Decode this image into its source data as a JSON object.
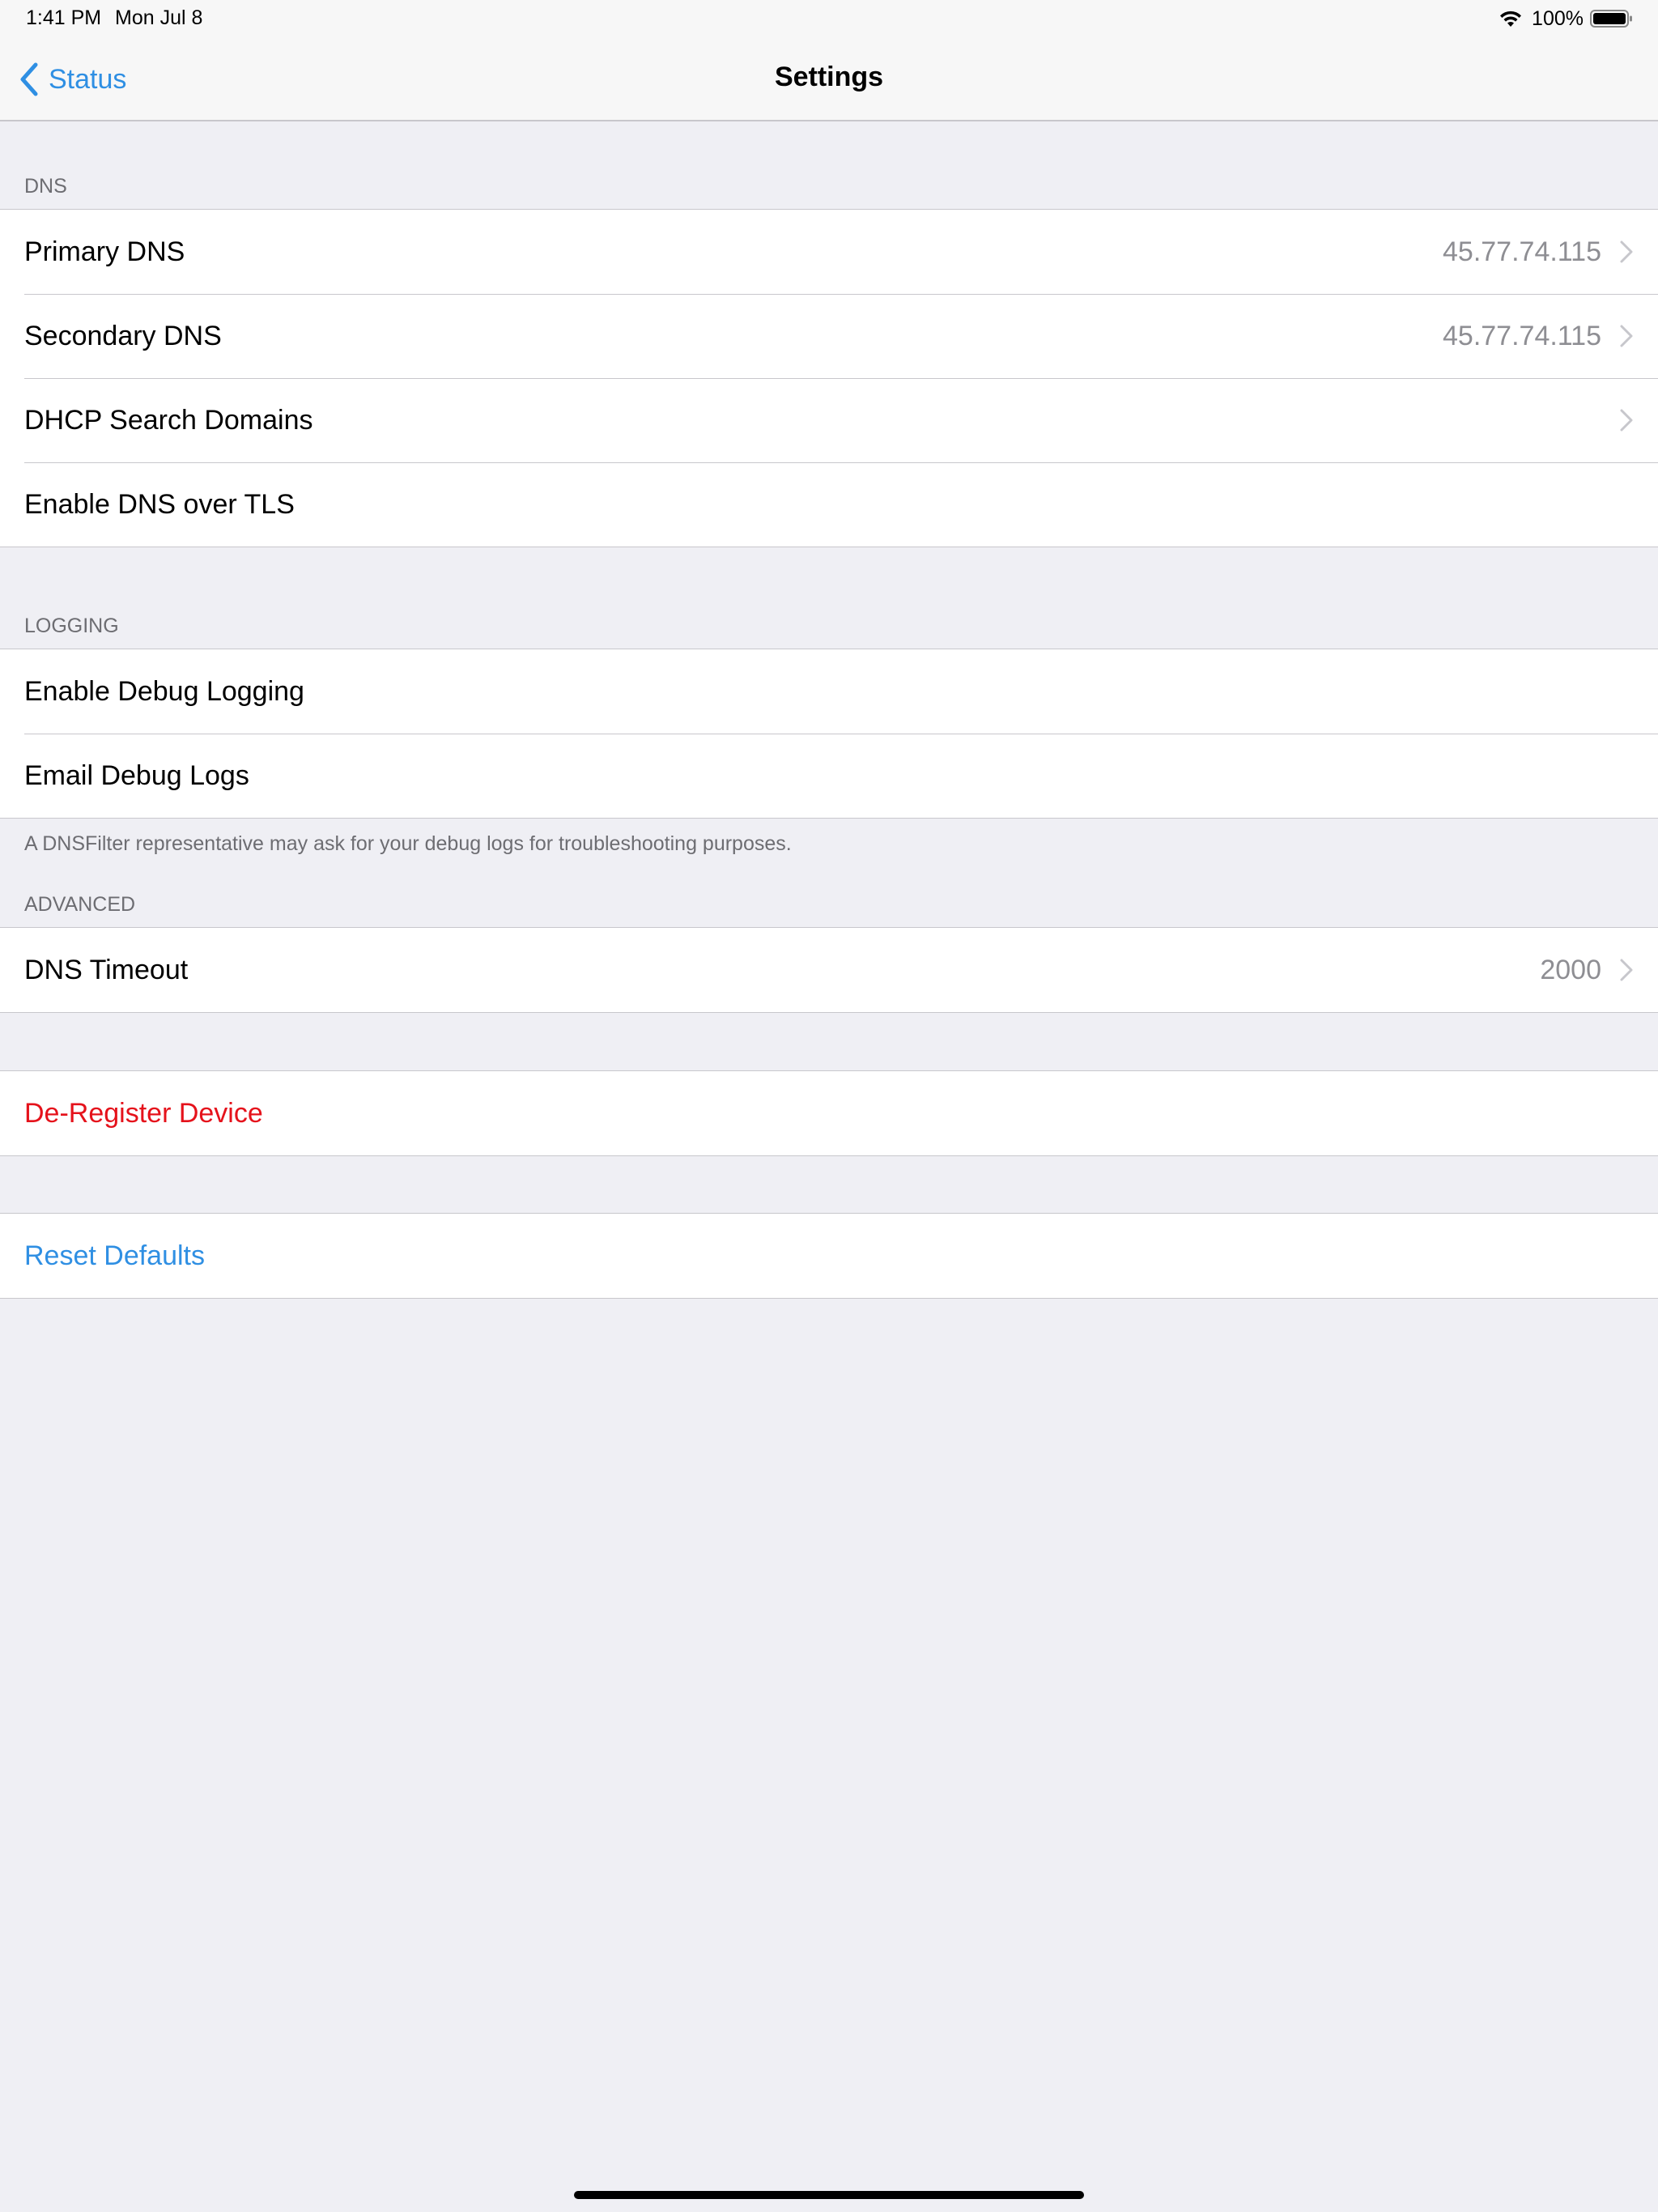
{
  "status_bar": {
    "time": "1:41 PM",
    "date": "Mon Jul 8",
    "battery_percent": "100%",
    "battery_level": 1.0
  },
  "nav": {
    "back_label": "Status",
    "title": "Settings"
  },
  "dns": {
    "header": "DNS",
    "rows": [
      {
        "label": "Primary DNS",
        "value": "45.77.74.115"
      },
      {
        "label": "Secondary DNS",
        "value": "45.77.74.115"
      },
      {
        "label": "DHCP Search Domains",
        "value": ""
      },
      {
        "label": "Enable DNS over TLS"
      }
    ]
  },
  "logging": {
    "header": "LOGGING",
    "rows": [
      {
        "label": "Enable Debug Logging"
      },
      {
        "label": "Email Debug Logs"
      }
    ],
    "footer": "A DNSFilter representative may ask for your debug logs for troubleshooting purposes."
  },
  "advanced": {
    "header": "ADVANCED",
    "rows": [
      {
        "label": "DNS Timeout",
        "value": "2000"
      }
    ]
  },
  "actions": {
    "deregister_label": "De-Register Device",
    "reset_label": "Reset Defaults"
  },
  "colors": {
    "accent": "#2f8fe3",
    "destructive": "#e5121b",
    "background": "#efeff4"
  }
}
